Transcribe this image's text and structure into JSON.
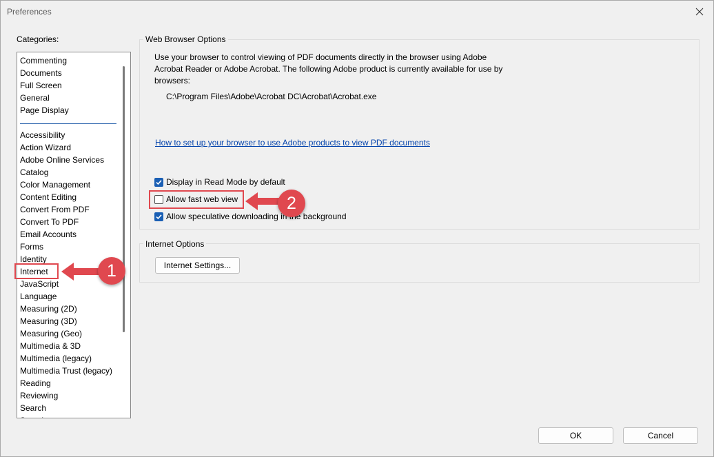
{
  "window": {
    "title": "Preferences"
  },
  "sidebar": {
    "label": "Categories:",
    "group1": [
      "Commenting",
      "Documents",
      "Full Screen",
      "General",
      "Page Display"
    ],
    "group2": [
      "Accessibility",
      "Action Wizard",
      "Adobe Online Services",
      "Catalog",
      "Color Management",
      "Content Editing",
      "Convert From PDF",
      "Convert To PDF",
      "Email Accounts",
      "Forms",
      "Identity",
      "Internet",
      "JavaScript",
      "Language",
      "Measuring (2D)",
      "Measuring (3D)",
      "Measuring (Geo)",
      "Multimedia & 3D",
      "Multimedia (legacy)",
      "Multimedia Trust (legacy)",
      "Reading",
      "Reviewing",
      "Search",
      "Security"
    ]
  },
  "web_browser": {
    "title": "Web Browser Options",
    "description": "Use your browser to control viewing of PDF documents directly in the browser using Adobe Acrobat Reader or Adobe Acrobat. The following Adobe product is currently available for use by browsers:",
    "path": "C:\\Program Files\\Adobe\\Acrobat DC\\Acrobat\\Acrobat.exe",
    "link": "How to set up your browser to use Adobe products to view PDF documents",
    "options": [
      {
        "label": "Display in Read Mode by default",
        "checked": true
      },
      {
        "label": "Allow fast web view",
        "checked": false
      },
      {
        "label": "Allow speculative downloading in the background",
        "checked": true
      }
    ]
  },
  "internet_options": {
    "title": "Internet Options",
    "button": "Internet Settings..."
  },
  "footer": {
    "ok": "OK",
    "cancel": "Cancel"
  },
  "annotations": {
    "step1": "1",
    "step2": "2",
    "color": "#e0484f"
  }
}
